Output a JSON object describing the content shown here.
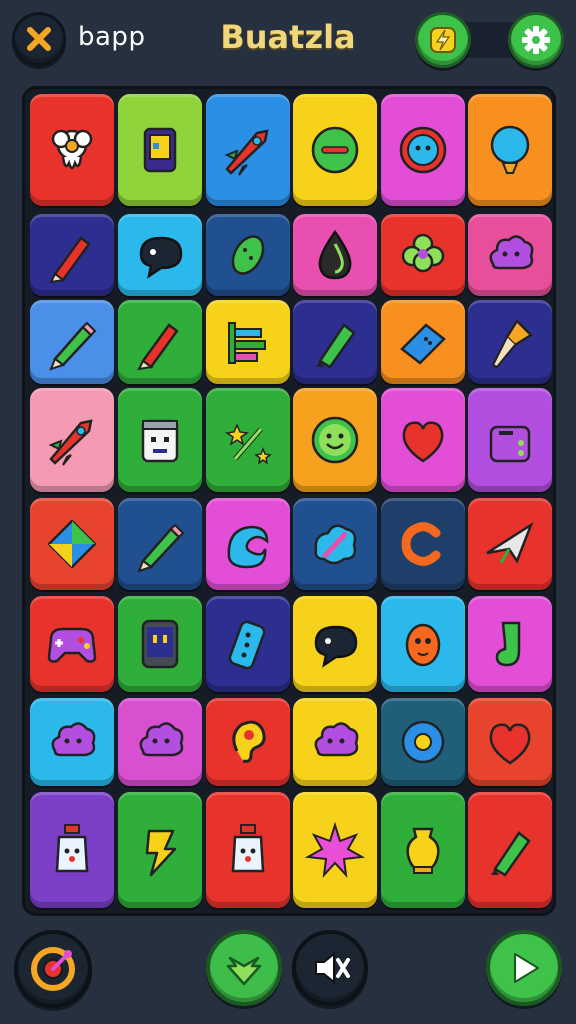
{
  "header": {
    "app_label": "bapp",
    "title": "Buatzla"
  },
  "colors": {
    "background": "#26303f",
    "board": "#161c26",
    "accent_green": "#3fc24a",
    "title_gold": "#f2d77a"
  },
  "board": {
    "rows": 8,
    "columns": 6,
    "tiles": [
      [
        {
          "color": "#e8332d",
          "icon": "flower-ghost-icon"
        },
        {
          "color": "#8fd43a",
          "icon": "tablet-icon"
        },
        {
          "color": "#2b8fe6",
          "icon": "rocket-icon"
        },
        {
          "color": "#f6d21a",
          "icon": "green-blob-icon"
        },
        {
          "color": "#e24fd6",
          "icon": "face-ring-icon"
        },
        {
          "color": "#f7901e",
          "icon": "balloon-icon"
        }
      ],
      [
        {
          "color": "#2c2f8f",
          "icon": "crayon-icon"
        },
        {
          "color": "#2bb9ec",
          "icon": "speech-bubble-icon"
        },
        {
          "color": "#20508f",
          "icon": "pickle-icon"
        },
        {
          "color": "#e84fb0",
          "icon": "drop-icon"
        },
        {
          "color": "#e8332d",
          "icon": "clover-icon"
        },
        {
          "color": "#e84f9a",
          "icon": "cloud-icon"
        }
      ],
      [
        {
          "color": "#4a8fe8",
          "icon": "pencil-icon"
        },
        {
          "color": "#2fae3a",
          "icon": "crayon-icon"
        },
        {
          "color": "#f6d21a",
          "icon": "bars-icon"
        },
        {
          "color": "#2c2f8f",
          "icon": "marker-icon"
        },
        {
          "color": "#f7901e",
          "icon": "eraser-icon"
        },
        {
          "color": "#2c2f8f",
          "icon": "brush-icon"
        }
      ],
      [
        {
          "color": "#f49ab2",
          "icon": "rocket-icon"
        },
        {
          "color": "#2fae3a",
          "icon": "robot-icon"
        },
        {
          "color": "#2fae3a",
          "icon": "star-wand-icon"
        },
        {
          "color": "#f7a21e",
          "icon": "smiley-icon"
        },
        {
          "color": "#e24fd6",
          "icon": "heart-icon"
        },
        {
          "color": "#b24fe0",
          "icon": "toaster-icon"
        }
      ],
      [
        {
          "color": "#e8442d",
          "icon": "kite-icon"
        },
        {
          "color": "#20508f",
          "icon": "pencil-icon"
        },
        {
          "color": "#e24fd6",
          "icon": "wave-icon"
        },
        {
          "color": "#20508f",
          "icon": "brush-splash-icon"
        },
        {
          "color": "#1f3f6b",
          "icon": "letter-c-icon"
        },
        {
          "color": "#e8332d",
          "icon": "plane-icon"
        }
      ],
      [
        {
          "color": "#e8332d",
          "icon": "gamepad-icon"
        },
        {
          "color": "#2fae3a",
          "icon": "phone-icon"
        },
        {
          "color": "#2c2f8f",
          "icon": "remote-icon"
        },
        {
          "color": "#f6d21a",
          "icon": "speech-bubble-icon"
        },
        {
          "color": "#2bb9ec",
          "icon": "creature-icon"
        },
        {
          "color": "#e24fd6",
          "icon": "sock-icon"
        }
      ],
      [
        {
          "color": "#2bb9ec",
          "icon": "cloud-icon"
        },
        {
          "color": "#d84fd0",
          "icon": "cloud-icon"
        },
        {
          "color": "#e8332d",
          "icon": "ear-icon"
        },
        {
          "color": "#f6d21a",
          "icon": "cloud-icon"
        },
        {
          "color": "#1f5f7a",
          "icon": "flower-icon"
        },
        {
          "color": "#e8442d",
          "icon": "heart-icon"
        }
      ],
      [
        {
          "color": "#7b3fc8",
          "icon": "bottle-icon"
        },
        {
          "color": "#2fae3a",
          "icon": "bolt-icon"
        },
        {
          "color": "#e8332d",
          "icon": "bottle-icon"
        },
        {
          "color": "#f6d21a",
          "icon": "burst-icon"
        },
        {
          "color": "#2fae3a",
          "icon": "vase-icon"
        },
        {
          "color": "#e8332d",
          "icon": "marker-icon"
        }
      ]
    ]
  },
  "footer": {
    "buttons": [
      {
        "name": "target-button",
        "icon": "target-icon"
      },
      {
        "name": "down-button",
        "icon": "down-arrow-icon"
      },
      {
        "name": "mute-button",
        "icon": "mute-icon"
      },
      {
        "name": "play-button",
        "icon": "play-icon"
      }
    ]
  }
}
